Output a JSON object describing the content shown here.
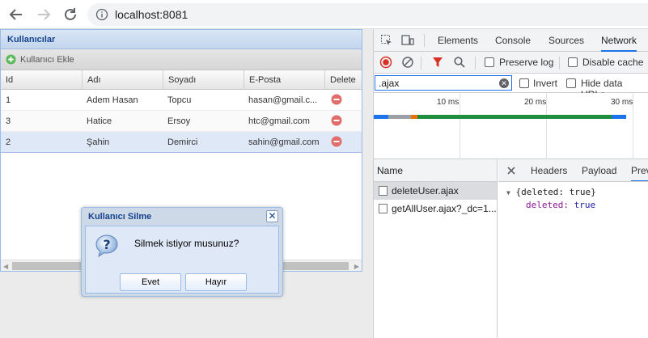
{
  "browser": {
    "url": "localhost:8081"
  },
  "app": {
    "panel_title": "Kullanıcılar",
    "add_button": "Kullanıcı Ekle",
    "columns": [
      "Id",
      "Adı",
      "Soyadı",
      "E-Posta",
      "Delete"
    ],
    "rows": [
      {
        "id": "1",
        "name": "Adem Hasan",
        "surname": "Topcu",
        "email": "hasan@gmail.c..."
      },
      {
        "id": "3",
        "name": "Hatice",
        "surname": "Ersoy",
        "email": "htc@gmail.com"
      },
      {
        "id": "2",
        "name": "Şahin",
        "surname": "Demirci",
        "email": "sahin@gmail.com"
      }
    ],
    "selected_row": 2
  },
  "dialog": {
    "title": "Kullanıcı Silme",
    "message": "Silmek istiyor musunuz?",
    "yes": "Evet",
    "no": "Hayır",
    "close": "✕"
  },
  "devtools": {
    "tabs": [
      "Elements",
      "Console",
      "Sources",
      "Network"
    ],
    "active_tab": "Network",
    "preserve_log": "Preserve log",
    "disable_cache": "Disable cache",
    "filter_value": ".ajax",
    "invert": "Invert",
    "hide_data_urls": "Hide data URLs",
    "timeline_ticks": [
      "10 ms",
      "20 ms",
      "30 ms"
    ],
    "name_header": "Name",
    "requests": [
      "deleteUser.ajax",
      "getAllUser.ajax?_dc=1..."
    ],
    "detail_tabs": [
      "Headers",
      "Payload",
      "Prev"
    ],
    "preview_line1": "{deleted: true}",
    "preview_key": "deleted",
    "preview_value": "true",
    "colors": {
      "accent": "#1a73e8",
      "record": "#d93025",
      "filter": "#d93025",
      "bar_green": "#1e8e3e",
      "bar_blue": "#1a73e8",
      "bar_gray": "#9aa0a6",
      "bar_orange": "#e8710a"
    }
  }
}
